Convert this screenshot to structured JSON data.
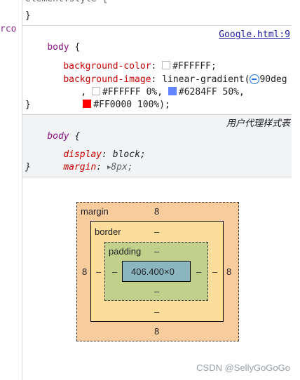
{
  "top_line": "element.style {",
  "top_close": "}",
  "gutter_fragment": "rco",
  "rule1": {
    "selector": "body",
    "open": " {",
    "source": "Google.html:9",
    "prop1_name": "background-color",
    "prop1_value": "#FFFFFF;",
    "prop2_name": "background-image",
    "prop2_value_a": "linear-gradient(",
    "prop2_value_b": "90deg",
    "stop1": "#FFFFFF 0%,",
    "stop2": "#6284FF 50%,",
    "stop3": "#FF0000 100%);",
    "close": "}",
    "colors": {
      "white": "#FFFFFF",
      "blue": "#6284FF",
      "red": "#FF0000"
    }
  },
  "rule2": {
    "selector": "body",
    "open": " {",
    "label": "用户代理样式表",
    "prop1_name": "display",
    "prop1_value": "block;",
    "prop2_name": "margin",
    "prop2_value": "8px;",
    "close": "}"
  },
  "box_model": {
    "margin_label": "margin",
    "margin_top": "8",
    "margin_bottom": "8",
    "margin_left": "8",
    "margin_right": "8",
    "border_label": "border",
    "border_top": "–",
    "border_bottom": "–",
    "border_left": "–",
    "border_right": "–",
    "padding_label": "padding",
    "padding_top": "–",
    "padding_bottom": "–",
    "padding_left": "–",
    "padding_right": "–",
    "content": "406.400×0"
  },
  "watermark": "CSDN @SellyGoGoGo"
}
